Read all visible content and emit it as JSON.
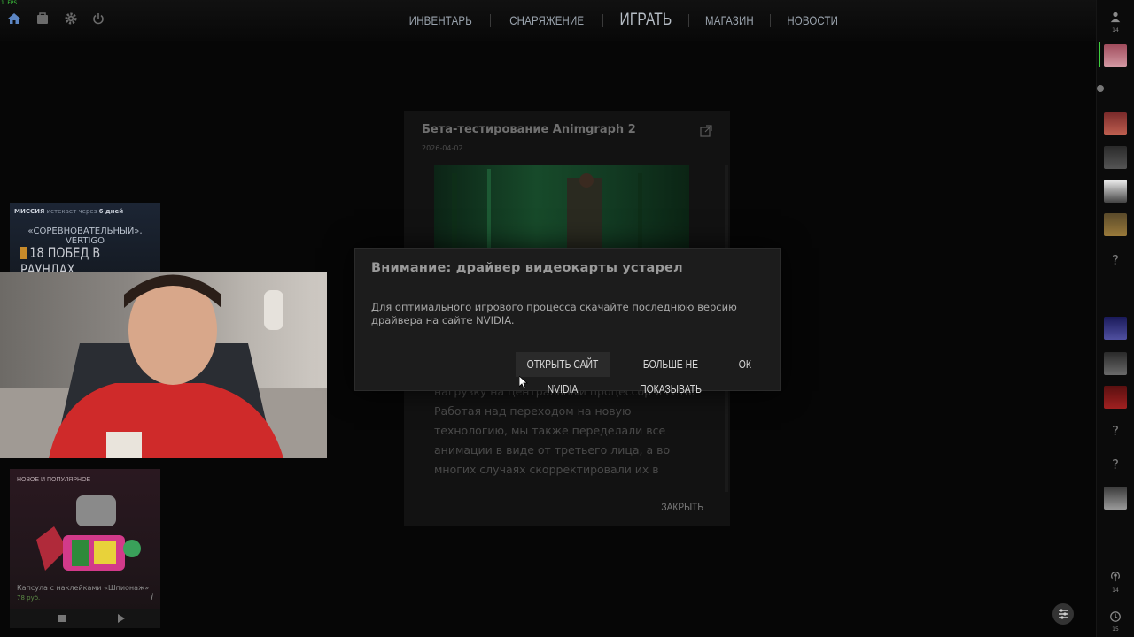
{
  "fps": "1 FPS",
  "topbar": {
    "icons": [
      "home-icon",
      "inventory-case-icon",
      "gear-icon",
      "power-icon"
    ],
    "nav": [
      {
        "label": "ИНВЕНТАРЬ"
      },
      {
        "label": "СНАРЯЖЕНИЕ"
      },
      {
        "label": "ИГРАТЬ"
      },
      {
        "label": "МАГАЗИН"
      },
      {
        "label": "НОВОСТИ"
      }
    ]
  },
  "rail": {
    "friends_count": "14",
    "bottom_count_1": "14",
    "bottom_count_2": "15"
  },
  "news": {
    "title": "Бета-тестирование Animgraph 2",
    "date": "2026-04-02",
    "body": "нагрузку на центральный процессор и сеть. Работая над переходом на новую технологию, мы также переделали все анимации в виде от третьего лица, а во многих случаях скорректировали их в",
    "close_label": "ЗАКРЫТЬ"
  },
  "dialog": {
    "title": "Внимание: драйвер видеокарты устарел",
    "text": "Для оптимального игрового процесса скачайте последнюю версию драйвера на сайте NVIDIA.",
    "btn_nvidia": "ОТКРЫТЬ САЙТ NVIDIA",
    "btn_nomore": "БОЛЬШЕ НЕ ПОКАЗЫВАТЬ",
    "btn_ok": "ОК"
  },
  "mission": {
    "label": "МИССИЯ",
    "expires": "истекает через",
    "expires_value": "6 дней",
    "mode": "«СОРЕВНОВАТЕЛЬНЫЙ», VERTIGO",
    "goal": "18 ПОБЕД В РАУНДАХ"
  },
  "promo": {
    "header": "НОВОЕ И ПОПУЛЯРНОЕ",
    "name": "Капсула с наклейками «Шпионаж»",
    "price": "78 руб."
  },
  "colors": {
    "background": "#060606",
    "dialog_bg": "#1c1c1c",
    "nav_text": "#9aa3ad",
    "accent_green": "#3fcf3f"
  }
}
